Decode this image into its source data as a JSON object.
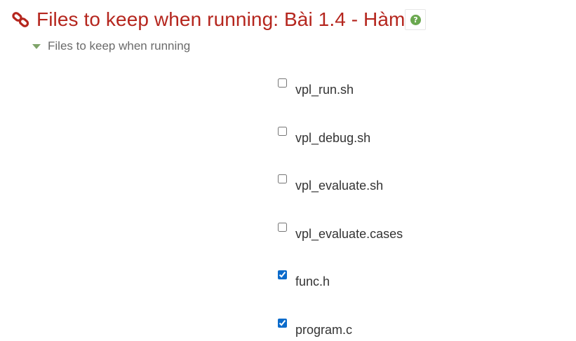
{
  "header": {
    "icon": "link-icon",
    "title": "Files to keep when running: Bài 1.4 - Hàm",
    "help_icon": "question-help-icon",
    "accent_color": "#b5261e"
  },
  "section": {
    "label": "Files to keep when running",
    "expanded": true,
    "toggle_icon": "caret-down-icon",
    "toggle_color": "#7fa46a"
  },
  "files": [
    {
      "name": "vpl_run.sh",
      "checked": false
    },
    {
      "name": "vpl_debug.sh",
      "checked": false
    },
    {
      "name": "vpl_evaluate.sh",
      "checked": false
    },
    {
      "name": "vpl_evaluate.cases",
      "checked": false
    },
    {
      "name": "func.h",
      "checked": true
    },
    {
      "name": "program.c",
      "checked": true
    }
  ]
}
